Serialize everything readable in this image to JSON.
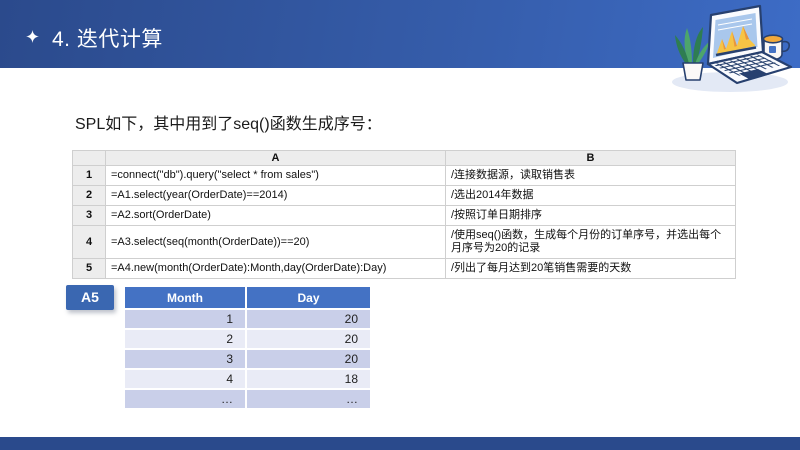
{
  "header": {
    "title": "4. 迭代计算"
  },
  "intro_text": "SPL如下，其中用到了seq()函数生成序号：",
  "code_table": {
    "col_a": "A",
    "col_b": "B",
    "rows": [
      {
        "num": "1",
        "code": "=connect(\"db\").query(\"select * from sales\")",
        "comment": "/连接数据源，读取销售表"
      },
      {
        "num": "2",
        "code": "=A1.select(year(OrderDate)==2014)",
        "comment": "/选出2014年数据"
      },
      {
        "num": "3",
        "code": "=A2.sort(OrderDate)",
        "comment": "/按照订单日期排序"
      },
      {
        "num": "4",
        "code": "=A3.select(seq(month(OrderDate))==20)",
        "comment": "/使用seq()函数，生成每个月份的订单序号，并选出每个月序号为20的记录"
      },
      {
        "num": "5",
        "code": "=A4.new(month(OrderDate):Month,day(OrderDate):Day)",
        "comment": "/列出了每月达到20笔销售需要的天数"
      }
    ]
  },
  "result_table": {
    "label": "A5",
    "headers": [
      "Month",
      "Day"
    ],
    "rows": [
      [
        "1",
        "20"
      ],
      [
        "2",
        "20"
      ],
      [
        "3",
        "20"
      ],
      [
        "4",
        "18"
      ],
      [
        "…",
        "…"
      ]
    ]
  },
  "icons": {
    "sparkle": "four-pointed-star-icon",
    "illustration": "isometric-laptop-with-plant-and-mug"
  },
  "colors": {
    "header_gradient_start": "#2B4A8C",
    "header_gradient_end": "#3D6CC6",
    "footer_bar": "#2A4A8C",
    "result_header_blue": "#4472C4",
    "row_alt_dark": "#C9CFE9",
    "row_alt_light": "#E9EBF6",
    "a5_label_bg": "#3A67B1",
    "grid_header_gray": "#EDEDED"
  }
}
